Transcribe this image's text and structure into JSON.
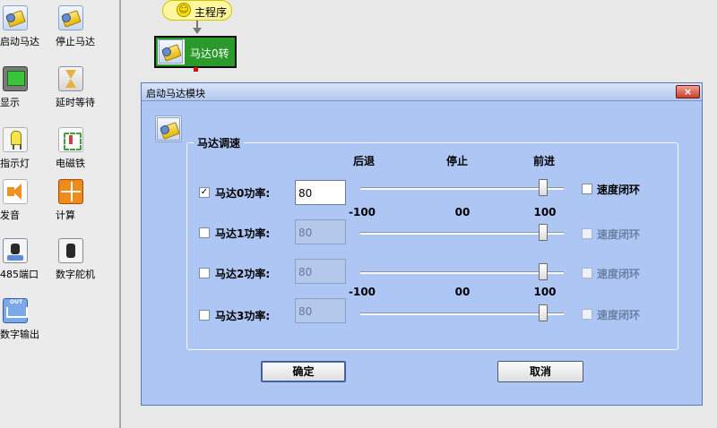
{
  "palette": {
    "items": [
      {
        "label": "启动马达",
        "icon": "motor-icon"
      },
      {
        "label": "停止马达",
        "icon": "motor-icon"
      },
      {
        "label": "显示",
        "icon": "display-icon"
      },
      {
        "label": "延时等待",
        "icon": "hourglass-icon"
      },
      {
        "label": "指示灯",
        "icon": "led-icon"
      },
      {
        "label": "电磁铁",
        "icon": "electromagnet-icon"
      },
      {
        "label": "发音",
        "icon": "speaker-icon"
      },
      {
        "label": "计算",
        "icon": "calculator-icon"
      },
      {
        "label": "485端口",
        "icon": "port-485-icon"
      },
      {
        "label": "数字舵机",
        "icon": "digital-servo-icon"
      },
      {
        "label": "数字输出",
        "icon": "digital-output-icon"
      }
    ],
    "output_icon_text": "OUT"
  },
  "canvas": {
    "start_block_label": "主程序",
    "motor_block_label": "马达0转"
  },
  "dialog": {
    "title": "启动马达模块",
    "close_label": "×",
    "group_label": "马达调速",
    "headers": {
      "backward": "后退",
      "stop": "停止",
      "forward": "前进"
    },
    "scale": {
      "min": "-100",
      "mid": "00",
      "max": "100"
    },
    "motors": [
      {
        "label": "马达0功率:",
        "checked": true,
        "check_mark": "✓",
        "value": "80",
        "enabled": true,
        "slider_fraction": 0.9,
        "loop_label": "速度闭环"
      },
      {
        "label": "马达1功率:",
        "checked": false,
        "check_mark": "",
        "value": "80",
        "enabled": false,
        "slider_fraction": 0.9,
        "loop_label": "速度闭环"
      },
      {
        "label": "马达2功率:",
        "checked": false,
        "check_mark": "",
        "value": "80",
        "enabled": false,
        "slider_fraction": 0.9,
        "loop_label": "速度闭环"
      },
      {
        "label": "马达3功率:",
        "checked": false,
        "check_mark": "",
        "value": "80",
        "enabled": false,
        "slider_fraction": 0.9,
        "loop_label": "速度闭环"
      }
    ],
    "ok_label": "确定",
    "cancel_label": "取消"
  }
}
